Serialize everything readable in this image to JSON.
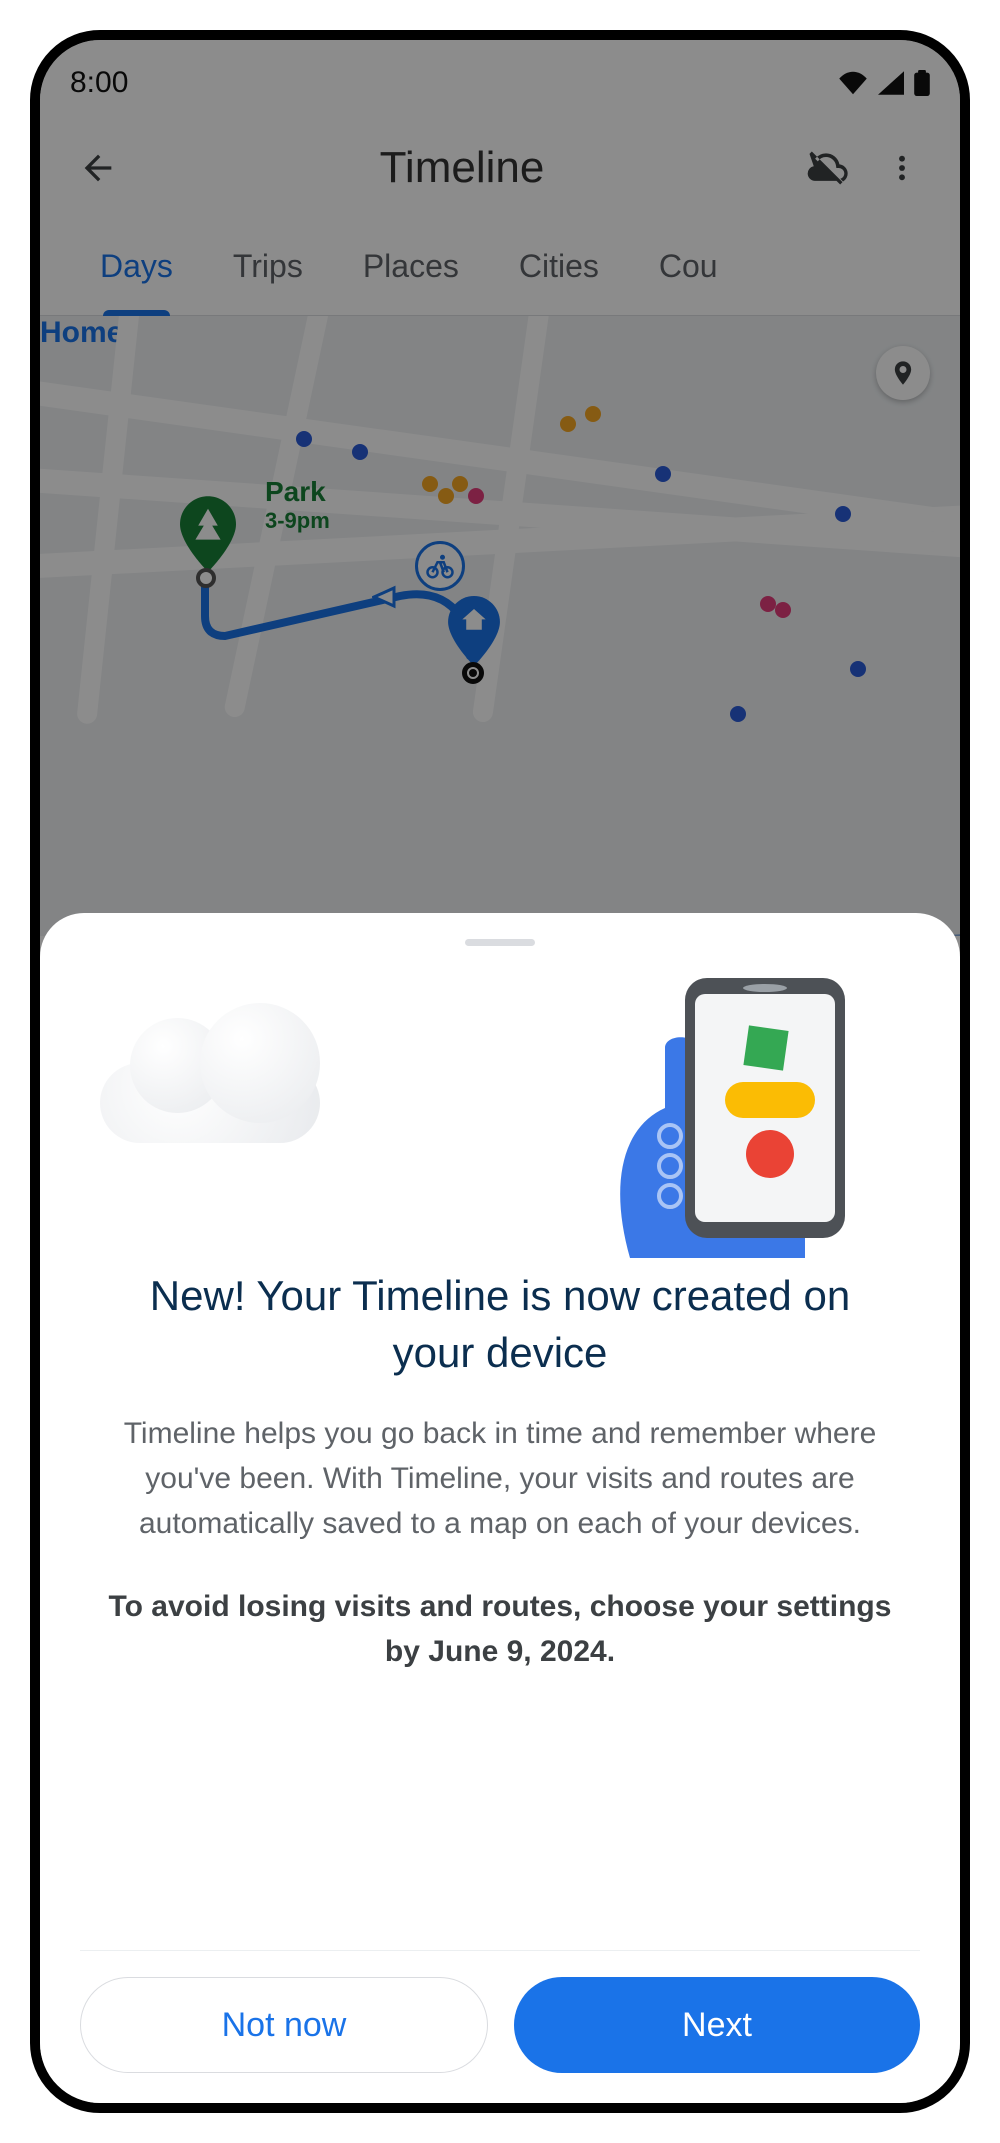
{
  "status": {
    "time": "8:00"
  },
  "header": {
    "title": "Timeline"
  },
  "tabs": {
    "items": [
      {
        "label": "Days",
        "active": true
      },
      {
        "label": "Trips"
      },
      {
        "label": "Places"
      },
      {
        "label": "Cities"
      },
      {
        "label": "Countries"
      }
    ]
  },
  "map": {
    "park": {
      "name": "Park",
      "time": "3-9pm"
    },
    "home": {
      "name": "Home"
    }
  },
  "sheet": {
    "title": "New! Your Timeline is now created on your device",
    "body": "Timeline helps you go back in time and remember where you've been.  With Timeline, your visits and routes are automatically saved to a map on each of your devices.",
    "emphasis": "To avoid losing visits and routes, choose your settings by June 9, 2024.",
    "secondary_label": "Not now",
    "primary_label": "Next"
  }
}
